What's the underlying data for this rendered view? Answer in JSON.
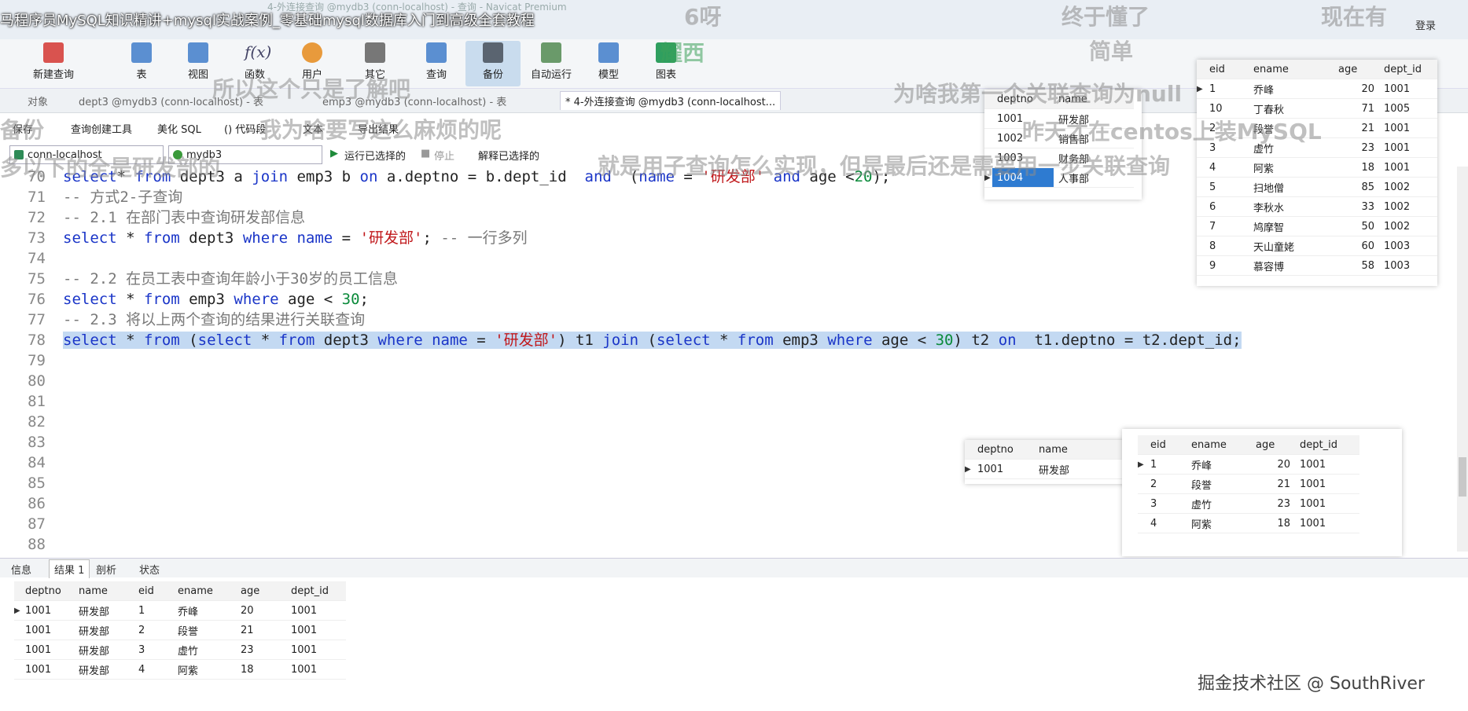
{
  "window": {
    "title": "马程序员MySQL知识精讲+mysql实战案例_零基础mysql数据库入门到高级全套教程",
    "subtitle": "4-外连接查询 @mydb3 (conn-localhost) - 查询 - Navicat Premium",
    "corner_label": "登录"
  },
  "ribbon": {
    "items": [
      {
        "label": "新建查询",
        "icon": "new-query-icon"
      },
      {
        "label": "表",
        "icon": "table-icon"
      },
      {
        "label": "视图",
        "icon": "view-icon"
      },
      {
        "label": "函数",
        "icon": "function-icon"
      },
      {
        "label": "用户",
        "icon": "user-icon"
      },
      {
        "label": "其它",
        "icon": "tools-icon"
      },
      {
        "label": "查询",
        "icon": "query-icon"
      },
      {
        "label": "备份",
        "icon": "backup-icon"
      },
      {
        "label": "自动运行",
        "icon": "auto-run-icon"
      },
      {
        "label": "模型",
        "icon": "model-icon"
      },
      {
        "label": "图表",
        "icon": "chart-icon"
      }
    ]
  },
  "tabs": [
    {
      "label": "对象"
    },
    {
      "label": "dept3 @mydb3 (conn-localhost) - 表"
    },
    {
      "label": "emp3 @mydb3 (conn-localhost) - 表"
    },
    {
      "label": "* 4-外连接查询 @mydb3 (conn-localhost..."
    }
  ],
  "toolbar": {
    "save": "保存",
    "query_builder": "查询创建工具",
    "beautify": "美化 SQL",
    "code_snippet": "() 代码段",
    "text": "文本",
    "export": "导出结果",
    "connection": "conn-localhost",
    "database": "mydb3",
    "run_selected": "运行已选择的",
    "stop": "停止",
    "explain": "解释已选择的"
  },
  "editor": {
    "lines": [
      {
        "n": "70",
        "code": [
          [
            "kw",
            "select"
          ],
          [
            "",
            "* "
          ],
          [
            "kw",
            "from"
          ],
          [
            "",
            " dept3 a "
          ],
          [
            "kw",
            "join"
          ],
          [
            "",
            " emp3 b "
          ],
          [
            "kw",
            "on"
          ],
          [
            "",
            " a.deptno = b.dept_id  "
          ],
          [
            "kw",
            "and"
          ],
          [
            "",
            "  ("
          ],
          [
            "kw",
            "name"
          ],
          [
            "",
            " = "
          ],
          [
            "str",
            "'研发部'"
          ],
          [
            "",
            " "
          ],
          [
            "kw",
            "and"
          ],
          [
            "",
            " age <"
          ],
          [
            "num2",
            "20"
          ],
          [
            "",
            ");"
          ]
        ]
      },
      {
        "n": "71",
        "code": [
          [
            "cm",
            "-- 方式2-子查询"
          ]
        ]
      },
      {
        "n": "72",
        "code": [
          [
            "cm",
            "-- 2.1 在部门表中查询研发部信息"
          ]
        ]
      },
      {
        "n": "73",
        "code": [
          [
            "kw",
            "select"
          ],
          [
            "",
            " * "
          ],
          [
            "kw",
            "from"
          ],
          [
            "",
            " dept3 "
          ],
          [
            "kw",
            "where"
          ],
          [
            "",
            " "
          ],
          [
            "kw",
            "name"
          ],
          [
            "",
            " = "
          ],
          [
            "str",
            "'研发部'"
          ],
          [
            "",
            "; "
          ],
          [
            "cm",
            "-- 一行多列"
          ]
        ]
      },
      {
        "n": "74",
        "code": []
      },
      {
        "n": "75",
        "code": [
          [
            "cm",
            "-- 2.2 在员工表中查询年龄小于30岁的员工信息"
          ]
        ]
      },
      {
        "n": "76",
        "code": [
          [
            "kw",
            "select"
          ],
          [
            "",
            " * "
          ],
          [
            "kw",
            "from"
          ],
          [
            "",
            " emp3 "
          ],
          [
            "kw",
            "where"
          ],
          [
            "",
            " age < "
          ],
          [
            "num2",
            "30"
          ],
          [
            "",
            ";"
          ]
        ]
      },
      {
        "n": "77",
        "code": [
          [
            "cm",
            "-- 2.3 将以上两个查询的结果进行关联查询"
          ]
        ]
      },
      {
        "n": "78",
        "hl": true,
        "code": [
          [
            "kw",
            "select"
          ],
          [
            "",
            " * "
          ],
          [
            "kw",
            "from"
          ],
          [
            "",
            " ("
          ],
          [
            "kw",
            "select"
          ],
          [
            "",
            " * "
          ],
          [
            "kw",
            "from"
          ],
          [
            "",
            " dept3 "
          ],
          [
            "kw",
            "where"
          ],
          [
            "",
            " "
          ],
          [
            "kw",
            "name"
          ],
          [
            "",
            " = "
          ],
          [
            "str",
            "'研发部'"
          ],
          [
            "",
            ") t1 "
          ],
          [
            "kw",
            "join"
          ],
          [
            "",
            " ("
          ],
          [
            "kw",
            "select"
          ],
          [
            "",
            " * "
          ],
          [
            "kw",
            "from"
          ],
          [
            "",
            " emp3 "
          ],
          [
            "kw",
            "where"
          ],
          [
            "",
            " age < "
          ],
          [
            "num2",
            "30"
          ],
          [
            "",
            ") t2 "
          ],
          [
            "kw",
            "on"
          ],
          [
            "",
            "  t1.deptno = t2.dept_id;"
          ]
        ]
      },
      {
        "n": "79",
        "code": []
      },
      {
        "n": "80",
        "code": []
      },
      {
        "n": "81",
        "code": []
      },
      {
        "n": "82",
        "code": []
      },
      {
        "n": "83",
        "code": []
      },
      {
        "n": "84",
        "code": []
      },
      {
        "n": "85",
        "code": []
      },
      {
        "n": "86",
        "code": []
      },
      {
        "n": "87",
        "code": []
      },
      {
        "n": "88",
        "code": []
      }
    ]
  },
  "dept_table": {
    "columns": [
      "deptno",
      "name"
    ],
    "rows": [
      [
        "1001",
        "研发部"
      ],
      [
        "1002",
        "销售部"
      ],
      [
        "1003",
        "财务部"
      ],
      [
        "1004",
        "人事部"
      ]
    ]
  },
  "emp_table": {
    "columns": [
      "eid",
      "ename",
      "age",
      "dept_id"
    ],
    "rows": [
      [
        "1",
        "乔峰",
        "20",
        "1001"
      ],
      [
        "10",
        "丁春秋",
        "71",
        "1005"
      ],
      [
        "2",
        "段誉",
        "21",
        "1001"
      ],
      [
        "3",
        "虚竹",
        "23",
        "1001"
      ],
      [
        "4",
        "阿紫",
        "18",
        "1001"
      ],
      [
        "5",
        "扫地僧",
        "85",
        "1002"
      ],
      [
        "6",
        "李秋水",
        "33",
        "1002"
      ],
      [
        "7",
        "鸠摩智",
        "50",
        "1002"
      ],
      [
        "8",
        "天山童姥",
        "60",
        "1003"
      ],
      [
        "9",
        "慕容博",
        "58",
        "1003"
      ]
    ]
  },
  "dept_result": {
    "columns": [
      "deptno",
      "name"
    ],
    "rows": [
      [
        "1001",
        "研发部"
      ]
    ]
  },
  "emp_result": {
    "columns": [
      "eid",
      "ename",
      "age",
      "dept_id"
    ],
    "rows": [
      [
        "1",
        "乔峰",
        "20",
        "1001"
      ],
      [
        "2",
        "段誉",
        "21",
        "1001"
      ],
      [
        "3",
        "虚竹",
        "23",
        "1001"
      ],
      [
        "4",
        "阿紫",
        "18",
        "1001"
      ]
    ]
  },
  "bottom_tabs": [
    "信息",
    "结果 1",
    "剖析",
    "状态"
  ],
  "result": {
    "columns": [
      "deptno",
      "name",
      "eid",
      "ename",
      "age",
      "dept_id"
    ],
    "rows": [
      [
        "1001",
        "研发部",
        "1",
        "乔峰",
        "20",
        "1001"
      ],
      [
        "1001",
        "研发部",
        "2",
        "段誉",
        "21",
        "1001"
      ],
      [
        "1001",
        "研发部",
        "3",
        "虚竹",
        "23",
        "1001"
      ],
      [
        "1001",
        "研发部",
        "4",
        "阿紫",
        "18",
        "1001"
      ]
    ]
  },
  "danmaku": [
    "6呀",
    "终于懂了",
    "现在有",
    "简单",
    "耀西",
    "所以这个只是了解吧",
    "为啥我第一个关联查询为null",
    "我为啥要写这么麻烦的呢",
    "昨天才在centos上装MySQL",
    "就是用子查询怎么实现，但是最后还是需要用一步关联查询",
    "多以下的全是研发部的",
    "备份"
  ],
  "watermark": "掘金技术社区 @ SouthRiver"
}
